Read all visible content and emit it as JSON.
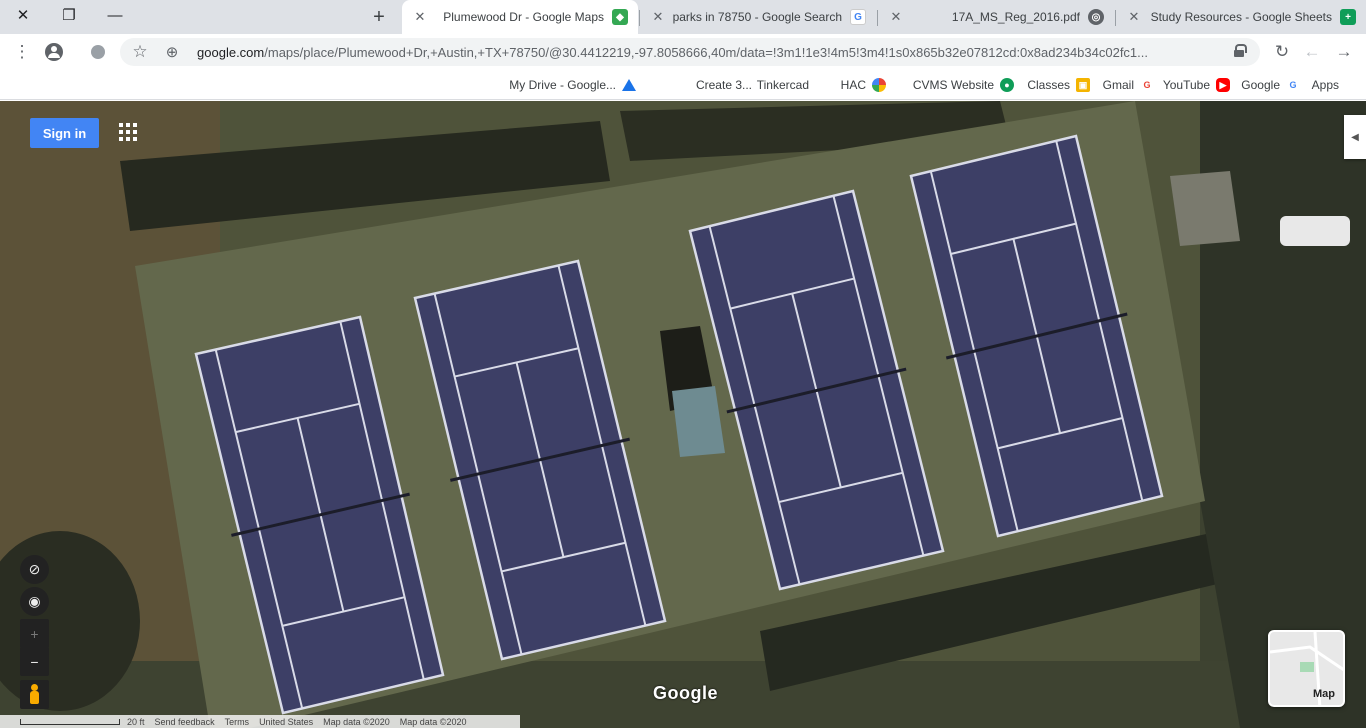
{
  "window_controls": {
    "close": "✕",
    "maximize": "❐",
    "minimize": "—"
  },
  "tabs": [
    {
      "title": "Study Resources - Google Sheets",
      "favicon": "sheets-icon",
      "color": "#0f9d58",
      "glyph": "+",
      "active": false
    },
    {
      "title": "17A_MS_Reg_2016.pdf",
      "favicon": "globe-icon",
      "color": "#5f6368",
      "glyph": "◎",
      "active": false
    },
    {
      "title": "parks in 78750 - Google Search",
      "favicon": "google-icon",
      "color": "#4285f4",
      "glyph": "G",
      "active": false
    },
    {
      "title": "Plumewood Dr - Google Maps",
      "favicon": "maps-icon",
      "color": "#34a853",
      "glyph": "◆",
      "active": true
    }
  ],
  "new_tab_label": "+",
  "toolbar": {
    "url_host": "google.com",
    "url_path": "/maps/place/Plumewood+Dr,+Austin,+TX+78750/@30.4412219,-97.8058666,40m/data=!3m1!1e3!4m5!3m4!1s0x865b32e07812cd:0x8ad234b34c02fc1..."
  },
  "bookmarks": [
    {
      "label": "Apps",
      "icon": "apps-icon",
      "color": "#ea4335"
    },
    {
      "label": "Google",
      "icon": "google-icon",
      "color": "#4285f4"
    },
    {
      "label": "YouTube",
      "icon": "youtube-icon",
      "color": "#ff0000"
    },
    {
      "label": "Gmail",
      "icon": "gmail-icon",
      "color": "#ea4335"
    },
    {
      "label": "Classes",
      "icon": "classes-icon",
      "color": "#f4b400"
    },
    {
      "label": "CVMS Website",
      "icon": "cvms-icon",
      "color": "#0f9d58"
    },
    {
      "label": "HAC",
      "icon": "hac-icon",
      "color": "#7b1fa2"
    },
    {
      "label": "Tinkercad",
      "icon": "tinkercad-icon",
      "color": "#e53935"
    },
    {
      "label": "Create 3...",
      "icon": "create-icon",
      "color": "#5f6368"
    },
    {
      "label": "My Drive - Google...",
      "icon": "drive-icon",
      "color": "#1a73e8"
    }
  ],
  "map": {
    "sign_in_label": "Sign in",
    "google_logo": "Google",
    "minimap_label": "Map",
    "side_toggle": "◀",
    "controls": {
      "compass": "⊘",
      "location": "◉",
      "zoom_in": "+",
      "zoom_out": "−"
    },
    "footer": [
      "Map data ©2020",
      "Map data ©2020",
      "United States",
      "Terms",
      "Send feedback",
      "20 ft"
    ]
  }
}
